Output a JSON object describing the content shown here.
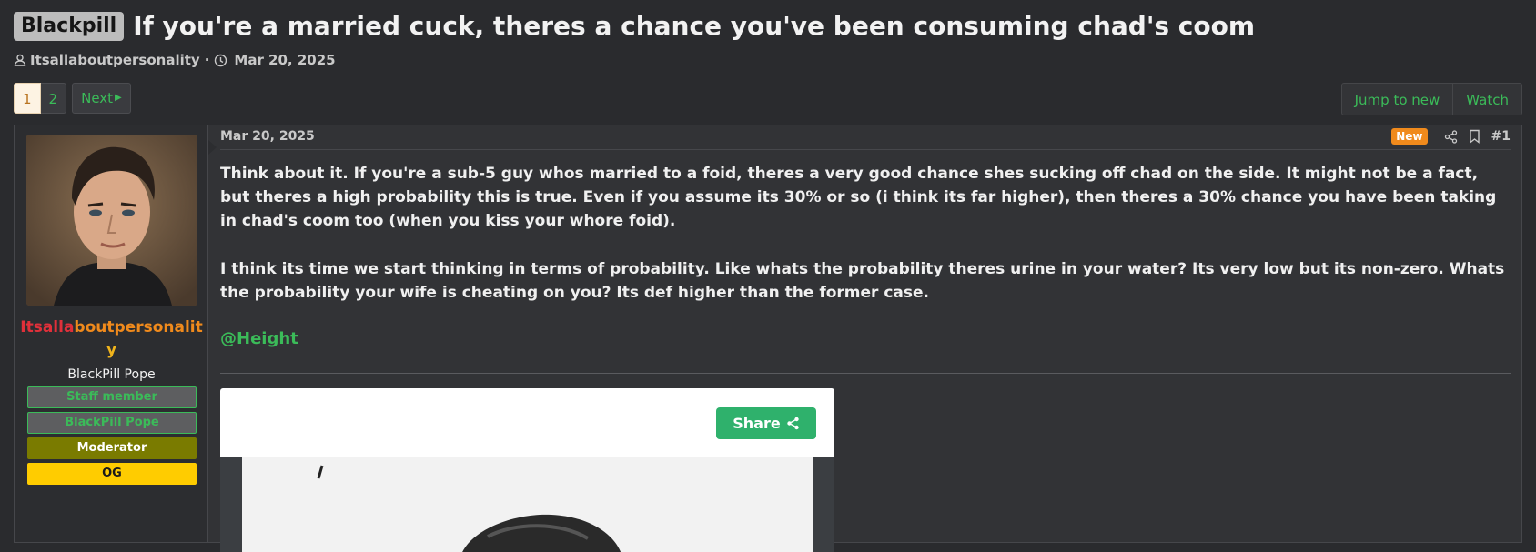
{
  "thread": {
    "prefix": "Blackpill",
    "title": "If you're a married cuck, theres a chance you've been consuming chad's coom",
    "author": "Itsallaboutpersonality",
    "separator": "·",
    "date": "Mar 20, 2025"
  },
  "pagination": {
    "pages": [
      "1",
      "2"
    ],
    "current": "1",
    "next_label": "Next"
  },
  "actions": {
    "jump_label": "Jump to new",
    "watch_label": "Watch"
  },
  "post": {
    "user": {
      "name_part1": "Itsalla",
      "name_part2": "boutpersonalit",
      "name_part3": "y",
      "title": "BlackPill Pope",
      "banners": [
        "Staff member",
        "BlackPill Pope",
        "Moderator",
        "OG"
      ]
    },
    "date": "Mar 20, 2025",
    "new_badge": "New",
    "number": "#1",
    "paragraph1": "Think about it. If you're a sub-5 guy whos married to a foid, theres a very good chance shes sucking off chad on the side. It might not be a fact, but theres a high probability this is true. Even if you assume its 30% or so (i think its far higher), then theres a 30% chance you have been taking in chad's coom too (when you kiss your whore foid).",
    "paragraph2": "I think its time we start thinking in terms of probability. Like whats the probability theres urine in your water? Its very low but its non-zero. Whats the probability your wife is cheating on you? Its def higher than the former case.",
    "mention": "@Height",
    "embed_share_label": "Share"
  },
  "colors": {
    "accent_green": "#3bbb59",
    "new_badge": "#f08a1c",
    "moderator": "#7a7b00",
    "og": "#ffcc00"
  }
}
